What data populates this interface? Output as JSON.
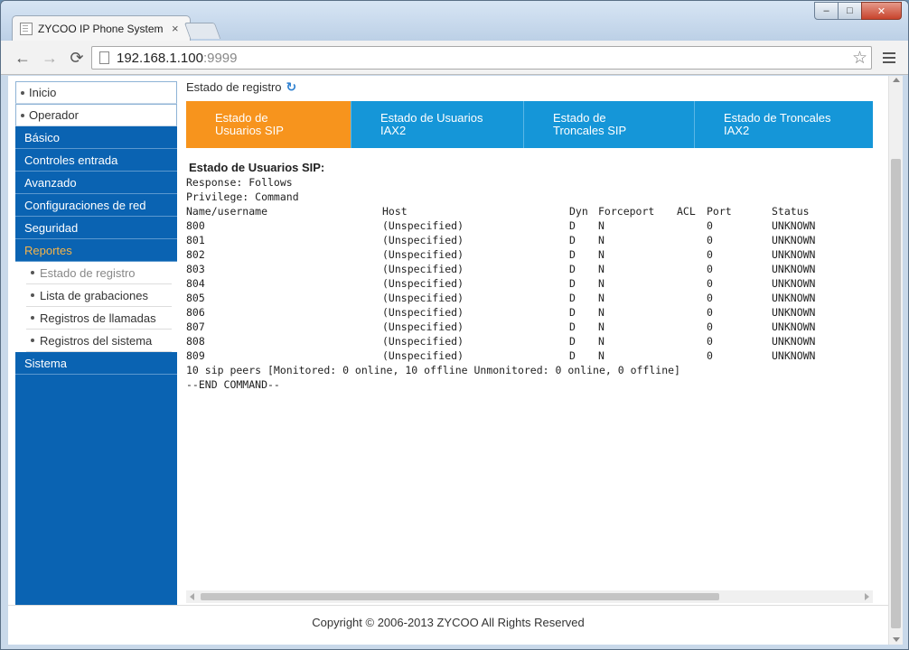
{
  "browser": {
    "tab_title": "ZYCOO IP Phone System (",
    "tab_close": "×",
    "url_host": "192.168.1.100",
    "url_port": ":9999",
    "icons": {
      "back": "arrow-left-icon",
      "forward": "arrow-right-icon",
      "reload": "reload-icon",
      "bookmark": "star-icon",
      "menu": "hamburger-menu-icon"
    },
    "window_buttons": {
      "minimize": "–",
      "maximize": "□",
      "close": "✕"
    }
  },
  "sidebar": {
    "top_items": [
      {
        "label": "Inicio"
      },
      {
        "label": "Operador"
      }
    ],
    "sections": [
      {
        "label": "Básico"
      },
      {
        "label": "Controles entrada"
      },
      {
        "label": "Avanzado"
      },
      {
        "label": "Configuraciones de red"
      },
      {
        "label": "Seguridad"
      },
      {
        "label": "Reportes"
      }
    ],
    "reportes_sub": [
      {
        "label": "Estado de registro"
      },
      {
        "label": "Lista de grabaciones"
      },
      {
        "label": "Registros de llamadas"
      },
      {
        "label": "Registros del sistema"
      }
    ],
    "last_section": {
      "label": "Sistema"
    },
    "colors": {
      "bg": "#0a63b2",
      "active": "#f4b44a"
    }
  },
  "breadcrumb": {
    "label": "Estado de registro",
    "refresh_icon": "↻"
  },
  "tabs": [
    {
      "label": "Estado de\nUsuarios SIP",
      "active": true
    },
    {
      "label": "Estado de Usuarios\nIAX2",
      "active": false
    },
    {
      "label": "Estado de\nTroncales SIP",
      "active": false
    },
    {
      "label": "Estado de Troncales\nIAX2",
      "active": false
    }
  ],
  "tab_colors": {
    "active": "#f7941d",
    "inactive": "#1596d8"
  },
  "report": {
    "title": "Estado de Usuarios SIP:",
    "response": "Response: Follows",
    "privilege": "Privilege: Command",
    "columns": {
      "name": "Name/username",
      "host": "Host",
      "dyn": "Dyn",
      "nat": "Forceport",
      "acl": "ACL",
      "port": "Port",
      "status": "Status"
    },
    "rows": [
      {
        "name": "800",
        "host": "(Unspecified)",
        "dyn": "D",
        "nat": "N",
        "acl": "",
        "port": "0",
        "status": "UNKNOWN"
      },
      {
        "name": "801",
        "host": "(Unspecified)",
        "dyn": "D",
        "nat": "N",
        "acl": "",
        "port": "0",
        "status": "UNKNOWN"
      },
      {
        "name": "802",
        "host": "(Unspecified)",
        "dyn": "D",
        "nat": "N",
        "acl": "",
        "port": "0",
        "status": "UNKNOWN"
      },
      {
        "name": "803",
        "host": "(Unspecified)",
        "dyn": "D",
        "nat": "N",
        "acl": "",
        "port": "0",
        "status": "UNKNOWN"
      },
      {
        "name": "804",
        "host": "(Unspecified)",
        "dyn": "D",
        "nat": "N",
        "acl": "",
        "port": "0",
        "status": "UNKNOWN"
      },
      {
        "name": "805",
        "host": "(Unspecified)",
        "dyn": "D",
        "nat": "N",
        "acl": "",
        "port": "0",
        "status": "UNKNOWN"
      },
      {
        "name": "806",
        "host": "(Unspecified)",
        "dyn": "D",
        "nat": "N",
        "acl": "",
        "port": "0",
        "status": "UNKNOWN"
      },
      {
        "name": "807",
        "host": "(Unspecified)",
        "dyn": "D",
        "nat": "N",
        "acl": "",
        "port": "0",
        "status": "UNKNOWN"
      },
      {
        "name": "808",
        "host": "(Unspecified)",
        "dyn": "D",
        "nat": "N",
        "acl": "",
        "port": "0",
        "status": "UNKNOWN"
      },
      {
        "name": "809",
        "host": "(Unspecified)",
        "dyn": "D",
        "nat": "N",
        "acl": "",
        "port": "0",
        "status": "UNKNOWN"
      }
    ],
    "summary": "10 sip peers [Monitored: 0 online, 10 offline Unmonitored: 0 online, 0 offline]",
    "end": "--END COMMAND--"
  },
  "footer": {
    "copyright": "Copyright © 2006-2013 ZYCOO All Rights Reserved"
  }
}
